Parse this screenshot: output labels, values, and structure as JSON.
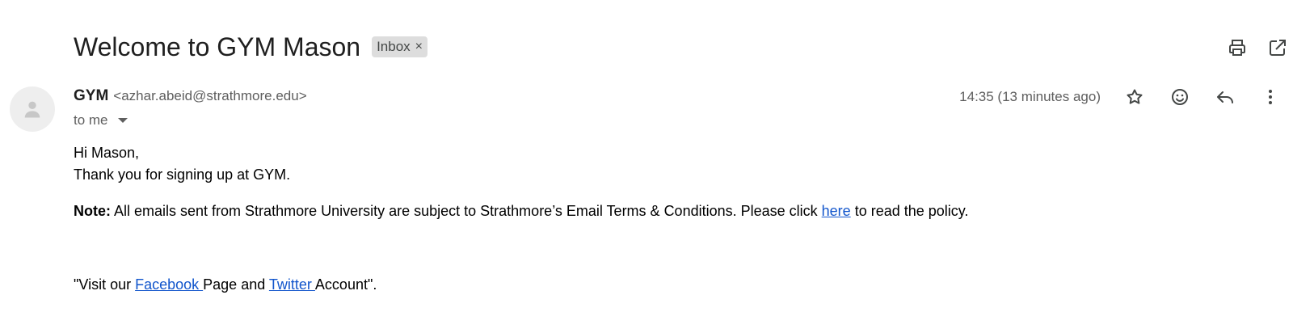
{
  "email": {
    "subject": "Welcome to GYM Mason",
    "label": "Inbox",
    "label_remove": "×",
    "sender_name": "GYM",
    "sender_email": "<azhar.abeid@strathmore.edu>",
    "recipient": "to me",
    "timestamp": "14:35 (13 minutes ago)"
  },
  "body": {
    "greeting": "Hi Mason,",
    "line1": "Thank you for signing up at GYM.",
    "note_label": "Note:",
    "note_text": " All emails sent from Strathmore University are subject to Strathmore’s Email Terms & Conditions. Please click ",
    "note_link": "here",
    "note_text_end": " to read the policy.",
    "social_prefix": "\"Visit our ",
    "facebook_link": "Facebook ",
    "social_middle": "Page and ",
    "twitter_link": "Twitter ",
    "social_suffix": "Account\"."
  },
  "icons": {
    "print": "print-icon",
    "open_new_window": "open-in-new-window-icon",
    "star": "star-icon",
    "emoji": "emoji-icon",
    "reply": "reply-icon",
    "more": "more-vert-icon",
    "avatar": "person-icon"
  }
}
